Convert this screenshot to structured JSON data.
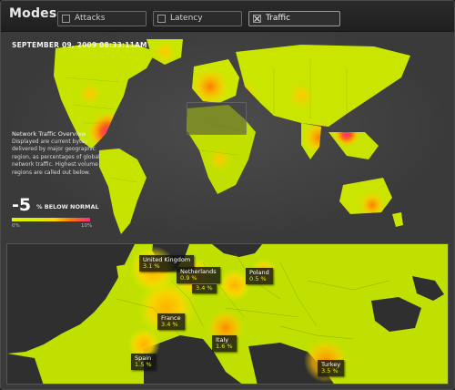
{
  "header": {
    "title": "Modes",
    "modes": [
      {
        "label": "Attacks",
        "checked": false
      },
      {
        "label": "Latency",
        "checked": false
      },
      {
        "label": "Traffic",
        "checked": true
      }
    ]
  },
  "overview": {
    "timestamp": "SEPTEMBER 09, 2009 08:33:11AM",
    "info_title": "Network Traffic Overview",
    "info_text": "Displayed are current bytes delivered by major geographic region, as percentages of global network traffic. Highest volume regions are called out below.",
    "value": "-5",
    "value_caption": "% BELOW NORMAL",
    "scale_min": "0%",
    "scale_max": "10%"
  },
  "regions": [
    {
      "name": "United Kingdom",
      "value": "3.1 %"
    },
    {
      "name": "Netherlands",
      "value": "0.9 %"
    },
    {
      "name": "",
      "value": "3.4 %"
    },
    {
      "name": "Poland",
      "value": "0.5 %"
    },
    {
      "name": "France",
      "value": "3.4 %"
    },
    {
      "name": "Italy",
      "value": "1.6 %"
    },
    {
      "name": "Spain",
      "value": "1.5 %"
    },
    {
      "name": "Turkey",
      "value": "3.5 %"
    }
  ],
  "colors": {
    "low": "#d6ef00",
    "mid": "#ffcf00",
    "high": "#ff6a00",
    "peak": "#ff2a8a",
    "background": "#3a3a3a"
  }
}
